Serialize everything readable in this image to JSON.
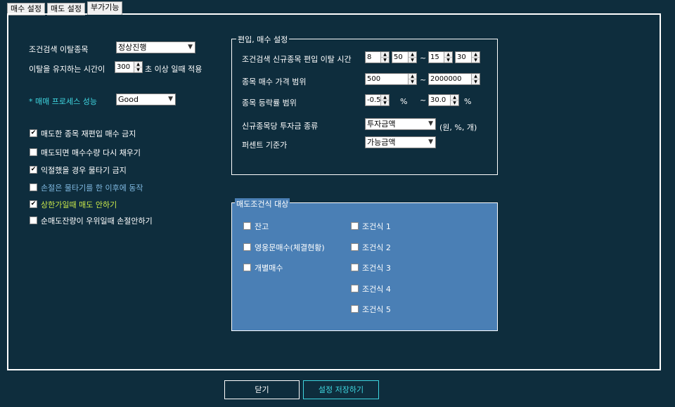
{
  "tabs": [
    "매수 설정",
    "매도 설정",
    "부가기능"
  ],
  "left": {
    "exit_label": "조건검색 이탈종목",
    "exit_select": "정상진행",
    "keep_label": "이탈을 유지하는 시간이",
    "keep_value": "300",
    "keep_suffix": "초 이상 일때 적용",
    "perf_label": "* 매매 프로세스 성능",
    "perf_select": "Good",
    "checkboxes": [
      {
        "label": "매도한 종목 재편입 매수 금지",
        "checked": "✔",
        "color": "#ffffff"
      },
      {
        "label": "매도되면 매수수량 다시 채우기",
        "checked": "",
        "color": "#ffffff"
      },
      {
        "label": "익절했을 경우 물타기 금지",
        "checked": "✔",
        "color": "#ffffff"
      },
      {
        "label": "손절은 물타기를 한 이후에 동작",
        "checked": "",
        "color": "#7fb8e0"
      },
      {
        "label": "상한가일때 매도 안하기",
        "checked": "✔",
        "color": "#c9e84a"
      },
      {
        "label": "순매도잔량이 우위일때 손절안하기",
        "checked": "",
        "color": "#ffffff"
      }
    ]
  },
  "buy_group": {
    "title": "편입, 매수 설정",
    "time_label": "조건검색 신규종목 편입 이탈 시간",
    "time_from_h": "8",
    "time_from_m": "50",
    "tilde": "~",
    "time_to_h": "15",
    "time_to_m": "30",
    "price_label": "종목 매수 가격 범위",
    "price_from": "500",
    "price_to": "2000000",
    "rate_label": "종목 등락률 범위",
    "rate_from": "-0.5",
    "rate_to": "30.0",
    "pct": "%",
    "invest_label": "신규종목당 투자금 종류",
    "invest_select": "투자금액",
    "invest_unit": "(원, %, 개)",
    "percent_label": "퍼센트 기준가",
    "percent_select": "가능금액"
  },
  "sell_group": {
    "title": "매도조건식 대상",
    "col1": [
      "잔고",
      "영웅문매수(체결현황)",
      "개별매수"
    ],
    "col2": [
      "조건식 1",
      "조건식 2",
      "조건식 3",
      "조건식 4",
      "조건식 5"
    ]
  },
  "buttons": {
    "close": "닫기",
    "save": "설정 저장하기"
  },
  "colors": {
    "background": "#0e2d3d",
    "sell_group_bg": "#4a7fb5",
    "accent_cyan": "#3fd6e0"
  }
}
